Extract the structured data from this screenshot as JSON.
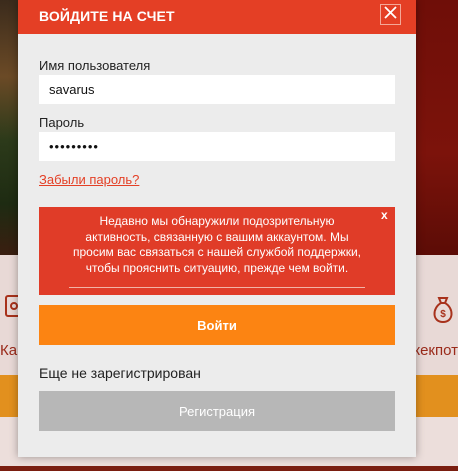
{
  "background": {
    "tile_left_label": "Ка",
    "tile_right_label": "жекпот",
    "tile_left_icon": "slot-machine-icon",
    "tile_right_icon": "money-bag-icon"
  },
  "modal": {
    "title": "ВОЙДИТЕ НА СЧЕТ",
    "close_icon": "close-icon",
    "username": {
      "label": "Имя пользователя",
      "value": "savarus"
    },
    "password": {
      "label": "Пароль",
      "value": "•••••••••"
    },
    "forgot_link": "Забыли пароль?",
    "alert": {
      "message": "Недавно мы обнаружили подозрительную активность, связанную с вашим аккаунтом. Мы просим вас связаться с нашей службой поддержки, чтобы прояснить ситуацию, прежде чем войти.",
      "close_label": "x"
    },
    "login_button": "Войти",
    "not_registered_text": "Еще не зарегистрирован",
    "register_button": "Регистрация"
  },
  "colors": {
    "header": "#e43f25",
    "alert": "#e03c28",
    "login_button": "#fc8412",
    "register_button": "#b7b7b7",
    "modal_bg": "#ececec"
  }
}
